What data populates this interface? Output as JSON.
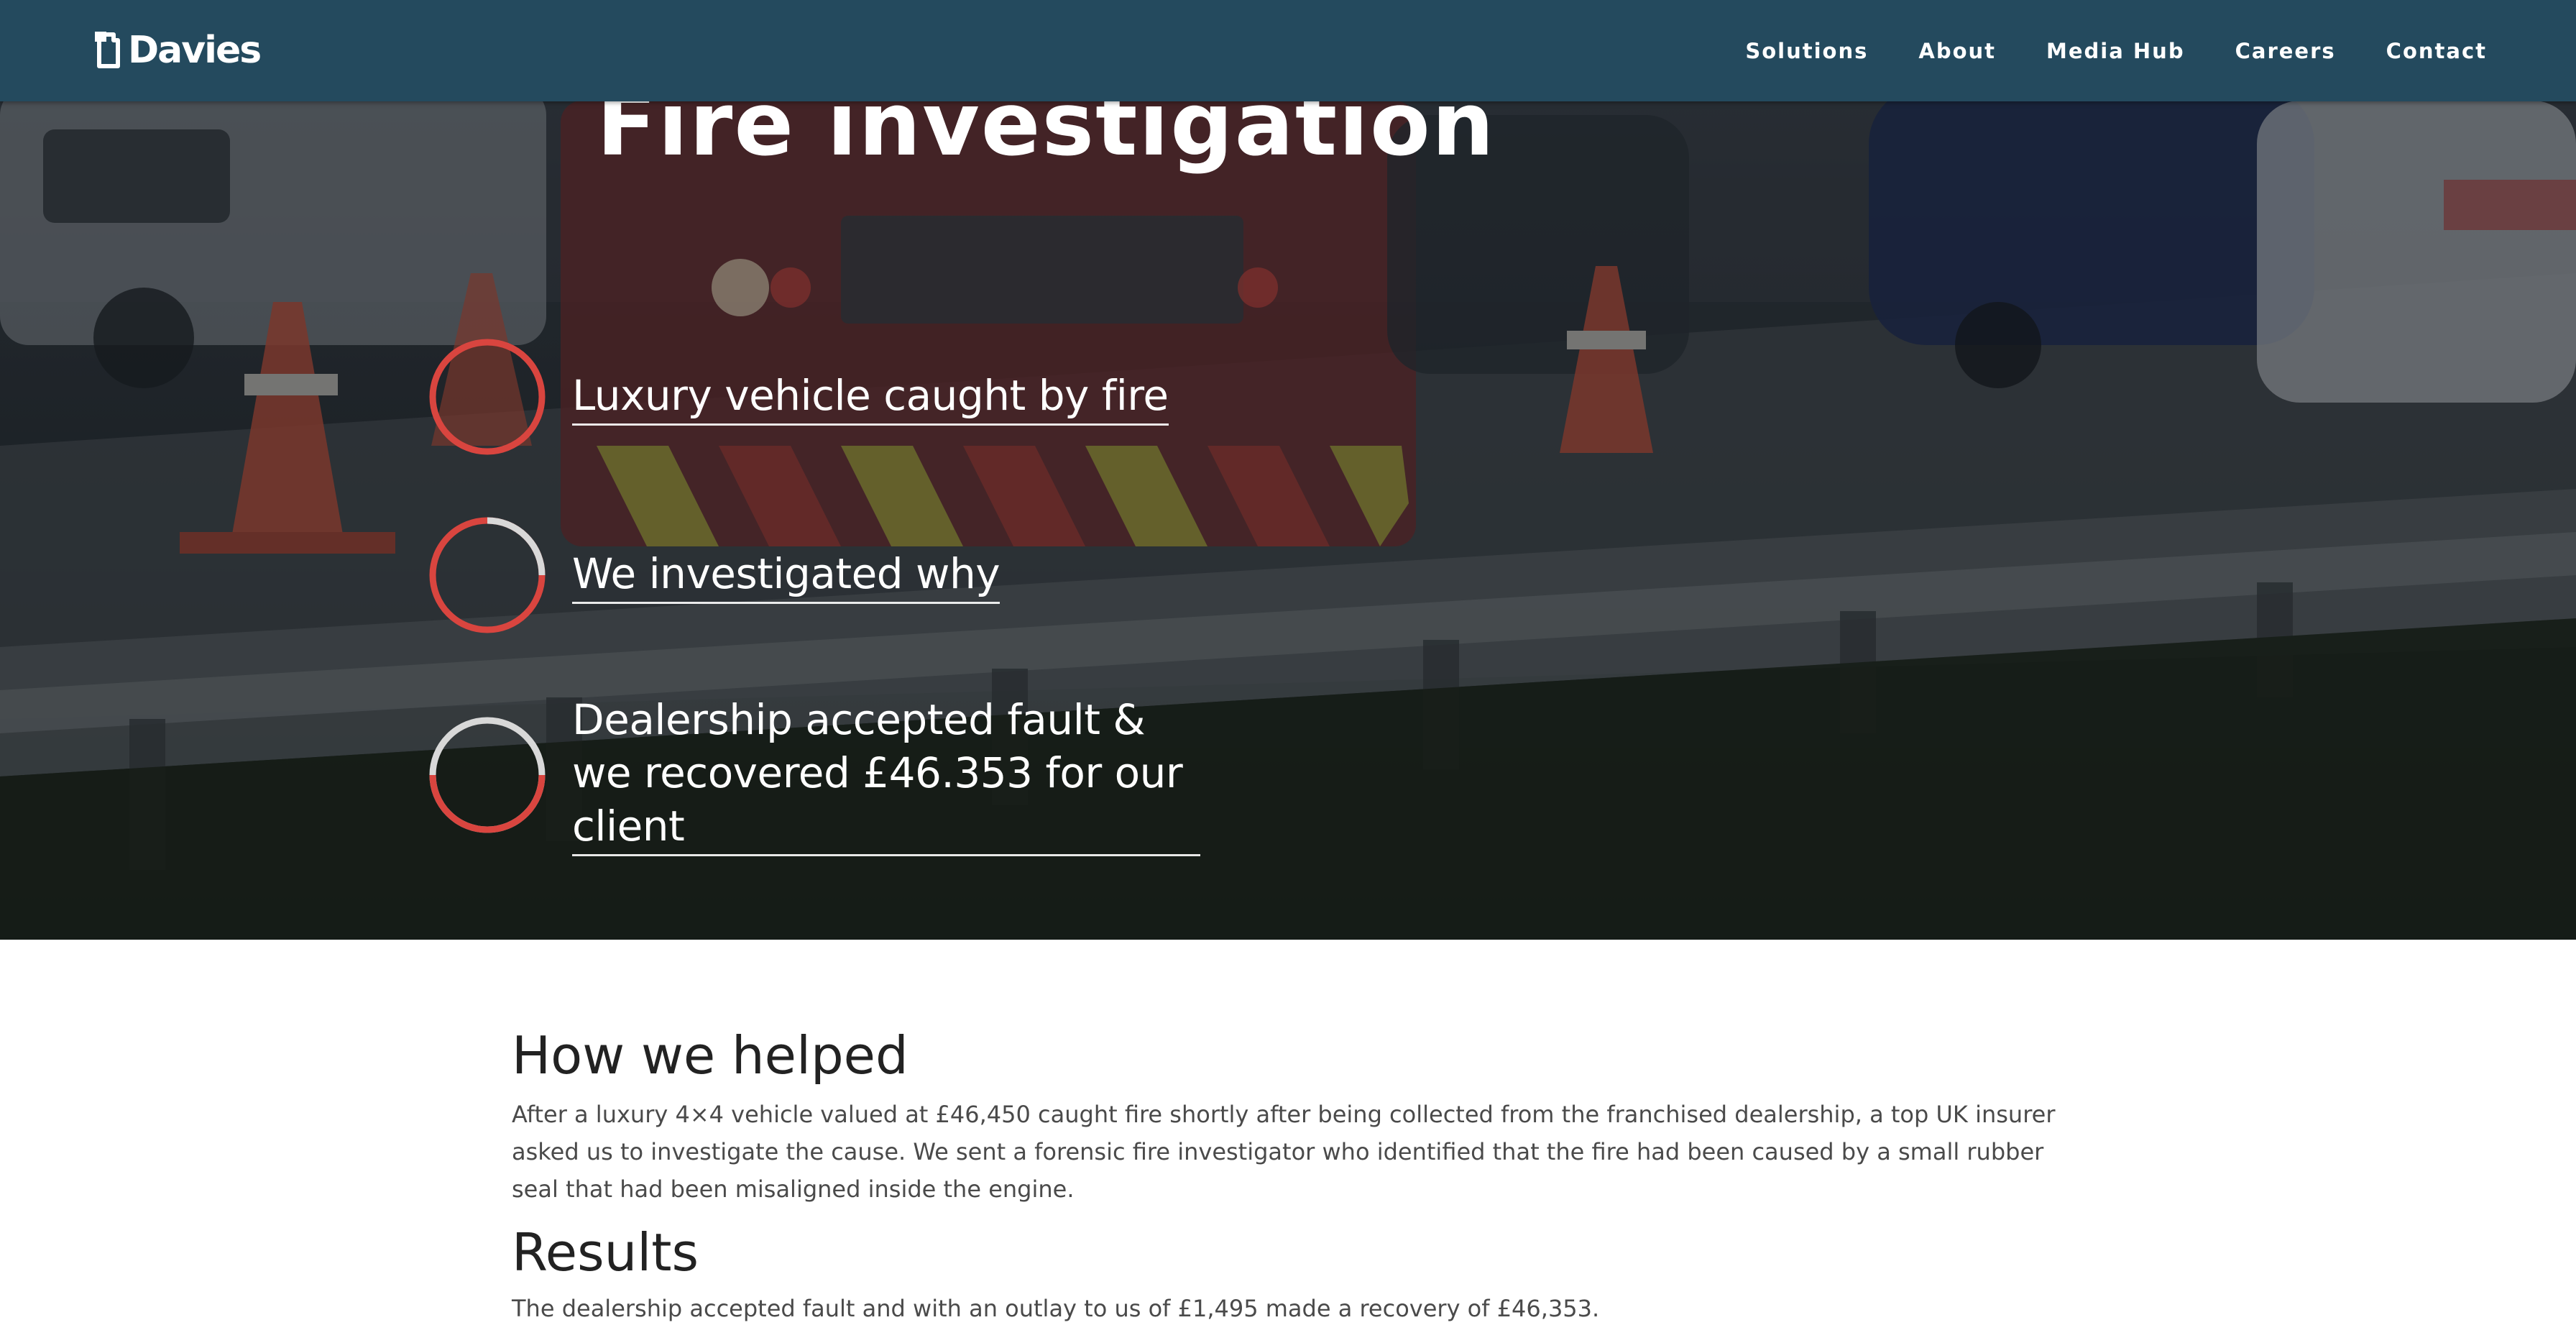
{
  "header": {
    "logo_text": "Davies",
    "nav": [
      "Solutions",
      "About",
      "Media Hub",
      "Careers",
      "Contact"
    ]
  },
  "hero": {
    "title": "Fire investigation",
    "steps": [
      {
        "text": "Luxury vehicle caught by fire",
        "progress": 0.0
      },
      {
        "text": "We investigated why",
        "progress": 0.33
      },
      {
        "text": "Dealership accepted fault & we recovered £46.353 for our client",
        "progress": 0.66
      }
    ]
  },
  "content": {
    "help_heading": "How we helped",
    "help_text": "After a luxury 4×4 vehicle valued at £46,450 caught fire shortly after being collected from the franchised dealership, a top UK insurer asked us to investigate the cause. We sent a forensic fire investigator who identified that the fire had been caused by a small rubber seal that had been misaligned inside the engine.",
    "results_heading": "Results",
    "results_text": "The dealership accepted fault and with an outlay to us of £1,495 made a recovery of £46,353."
  },
  "colors": {
    "navbar": "#244a5e",
    "accent_red": "#d9453f",
    "ring_track": "#d8d8d8"
  },
  "icons": [
    "davies-logo-icon",
    "progress-ring-icon"
  ]
}
